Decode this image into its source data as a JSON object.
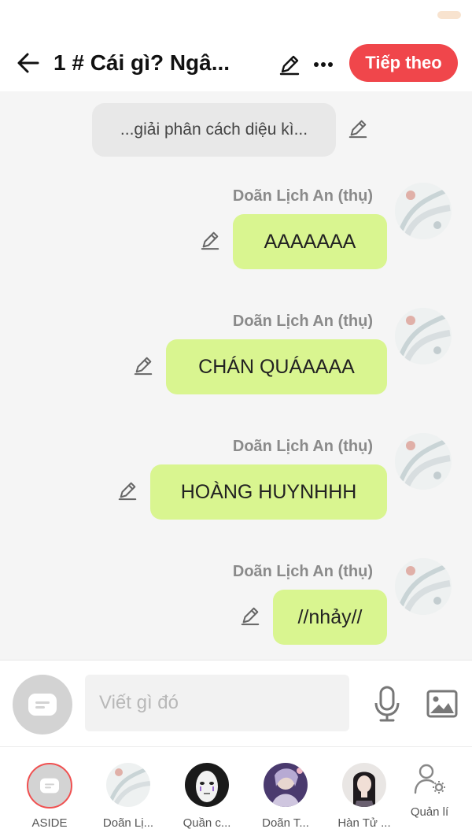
{
  "header": {
    "title": "1 # Cái gì? Ngâ...",
    "next_label": "Tiếp theo"
  },
  "narration": {
    "text": "...giải phân cách diệu kì..."
  },
  "messages": [
    {
      "sender": "Doãn Lịch An (thụ)",
      "text": "AAAAAAA"
    },
    {
      "sender": "Doãn Lịch An (thụ)",
      "text": "CHÁN QUÁAAAA"
    },
    {
      "sender": "Doãn Lịch An (thụ)",
      "text": "HOÀNG HUYNHHH"
    },
    {
      "sender": "Doãn Lịch An (thụ)",
      "text": "//nhảy//"
    }
  ],
  "composer": {
    "placeholder": "Viết gì đó"
  },
  "characters": [
    {
      "label": "ASIDE"
    },
    {
      "label": "Doãn Lị..."
    },
    {
      "label": "Quần c..."
    },
    {
      "label": "Doãn T..."
    },
    {
      "label": "Hàn Tử ..."
    },
    {
      "label": "Quản lí"
    }
  ],
  "colors": {
    "accent": "#f0464b",
    "bubble": "#d9f590",
    "background": "#f5f5f5"
  },
  "icons": [
    "back-arrow-icon",
    "pencil-icon",
    "more-icon",
    "aside-chat-icon",
    "microphone-icon",
    "image-icon",
    "manage-user-icon"
  ]
}
